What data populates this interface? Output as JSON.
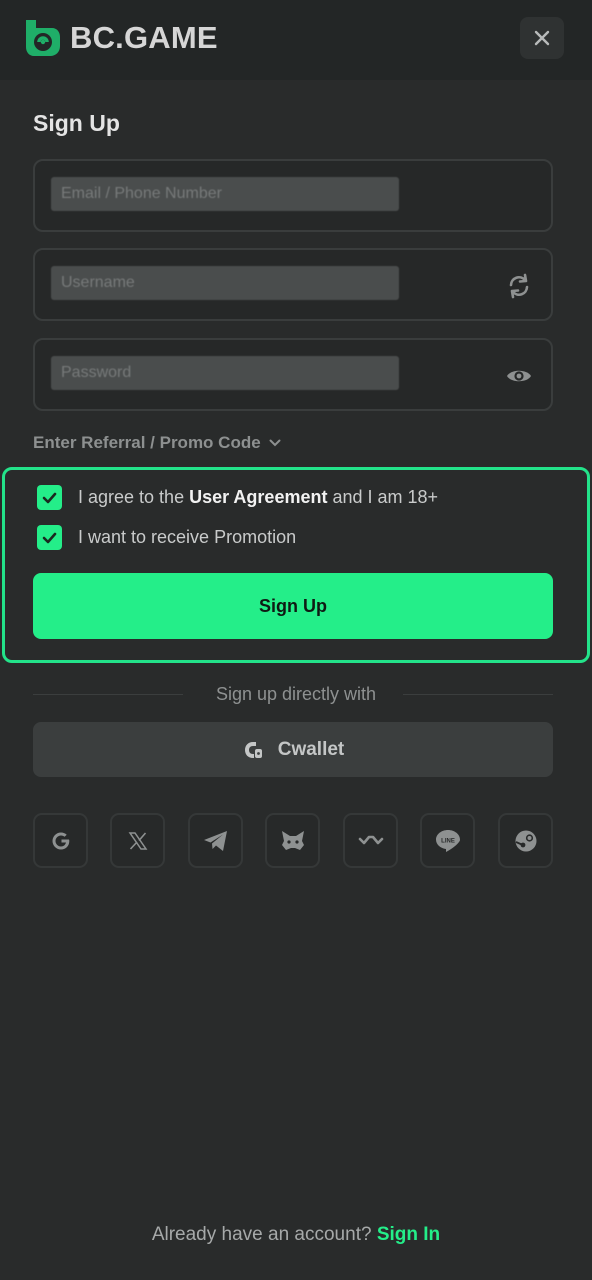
{
  "header": {
    "logo_text": "BC.GAME",
    "close_icon": "close-icon"
  },
  "form": {
    "title": "Sign Up",
    "fields": [
      {
        "placeholder": "Email / Phone Number",
        "icon": ""
      },
      {
        "placeholder": "Username",
        "icon": "refresh-icon"
      },
      {
        "placeholder": "Password",
        "icon": "eye-icon"
      }
    ],
    "promo_label": "Enter Referral / Promo Code",
    "agreement_prefix": "I agree to the ",
    "agreement_link": "User Agreement",
    "agreement_suffix": " and I am 18+",
    "promotion_label": "I want to receive Promotion",
    "submit_label": "Sign Up"
  },
  "alt": {
    "divider_text": "Sign up directly with",
    "cwallet_label": "Cwallet",
    "socials": [
      "google-icon",
      "x-icon",
      "telegram-icon",
      "metamask-icon",
      "walletconnect-icon",
      "line-icon",
      "steam-icon"
    ]
  },
  "footer": {
    "prompt": "Already have an account? ",
    "link": "Sign In"
  },
  "colors": {
    "accent": "#24ee89",
    "background": "#292b2b",
    "header": "#232626"
  }
}
